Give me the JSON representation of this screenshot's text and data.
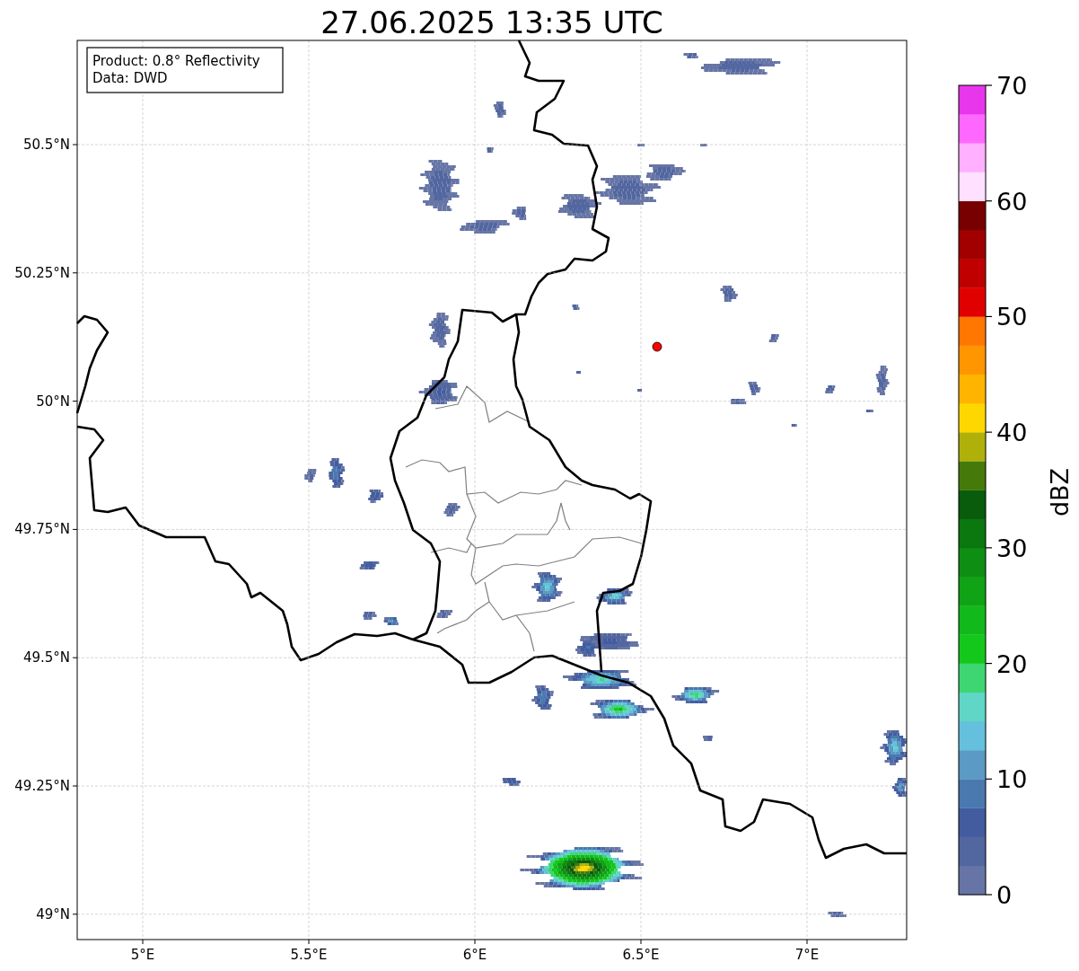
{
  "title": "27.06.2025 13:35 UTC",
  "info_box": {
    "lines": [
      "Product: 0.8° Reflectivity",
      "Data: DWD"
    ]
  },
  "x_ticks": [
    "5°E",
    "5.5°E",
    "6°E",
    "6.5°E",
    "7°E"
  ],
  "y_ticks": [
    "50.5°N",
    "50.25°N",
    "50°N",
    "49.75°N",
    "49.5°N",
    "49.25°N",
    "49°N"
  ],
  "colorbar": {
    "label": "dBZ",
    "ticks": [
      "70",
      "60",
      "50",
      "40",
      "30",
      "20",
      "10",
      "0"
    ],
    "bins": [
      {
        "color": "#6675a5"
      },
      {
        "color": "#5266a0"
      },
      {
        "color": "#425c9f"
      },
      {
        "color": "#4a79b0"
      },
      {
        "color": "#5a9ac4"
      },
      {
        "color": "#64c0dc"
      },
      {
        "color": "#60d6c6"
      },
      {
        "color": "#3dd672"
      },
      {
        "color": "#13c81a"
      },
      {
        "color": "#12b91a"
      },
      {
        "color": "#10a315"
      },
      {
        "color": "#0e8e12"
      },
      {
        "color": "#0a770f"
      },
      {
        "color": "#085c0b"
      },
      {
        "color": "#457a0b"
      },
      {
        "color": "#afb00a"
      },
      {
        "color": "#ffd700"
      },
      {
        "color": "#ffb400"
      },
      {
        "color": "#ff9600"
      },
      {
        "color": "#ff7700"
      },
      {
        "color": "#e00000"
      },
      {
        "color": "#c00000"
      },
      {
        "color": "#a00000"
      },
      {
        "color": "#780000"
      },
      {
        "color": "#ffe0ff"
      },
      {
        "color": "#ffb0ff"
      },
      {
        "color": "#ff68ff"
      },
      {
        "color": "#e836ec"
      }
    ]
  }
}
